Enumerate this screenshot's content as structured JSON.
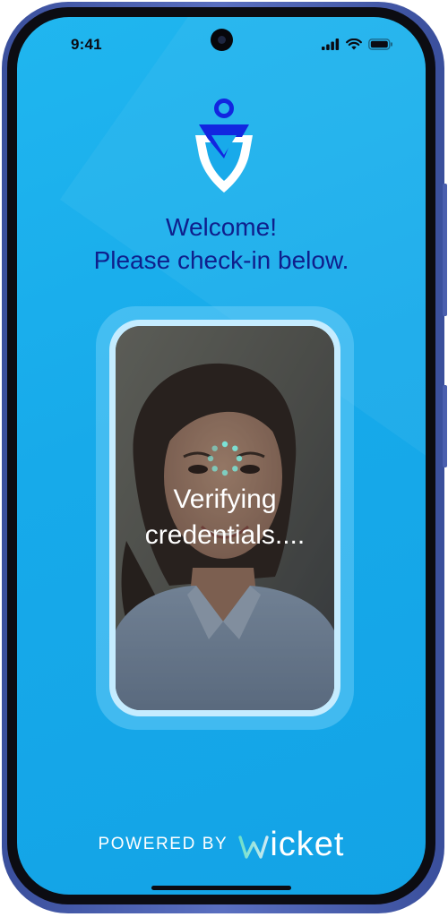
{
  "status_bar": {
    "time": "9:41",
    "icons": [
      "signal-icon",
      "wifi-icon",
      "battery-icon"
    ]
  },
  "logo": {
    "icon": "person-shield-logo",
    "colors": {
      "figure": "#1226e0",
      "shield": "#ffffff"
    }
  },
  "welcome": {
    "line1": "Welcome!",
    "line2": "Please check-in below."
  },
  "camera": {
    "status_line1": "Verifying",
    "status_line2": "credentials....",
    "spinner_icon": "loading-spinner-icon"
  },
  "footer": {
    "powered_by": "POWERED BY",
    "brand_first_letter": "w",
    "brand_rest": "icket",
    "brand_icon": "wicket-logo"
  },
  "colors": {
    "screen_bg": "#17aaea",
    "heading_text": "#0f1f8c",
    "spinner": "#7be3d6",
    "brand_w_gradient": [
      "#6ee0c9",
      "#cfe9f5"
    ]
  }
}
